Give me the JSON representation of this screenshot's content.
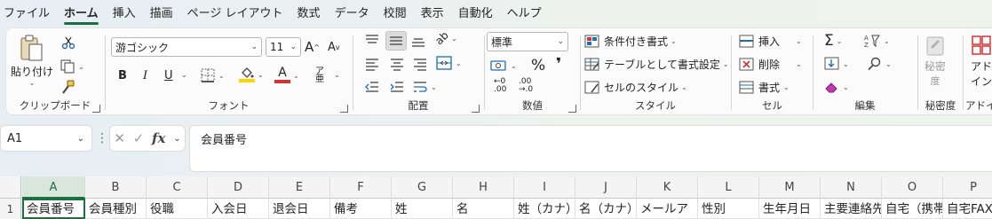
{
  "menu": [
    "ファイル",
    "ホーム",
    "挿入",
    "描画",
    "ページ レイアウト",
    "数式",
    "データ",
    "校閲",
    "表示",
    "自動化",
    "ヘルプ"
  ],
  "active_tab": "ホーム",
  "clipboard": {
    "paste_label": "貼り付け",
    "group_label": "クリップボード"
  },
  "font": {
    "font_name": "游ゴシック",
    "font_size": "11",
    "bold": "B",
    "italic": "I",
    "underline": "U",
    "group_label": "フォント",
    "underline_color": "#ffd400",
    "font_color": "#d13438"
  },
  "alignment": {
    "group_label": "配置"
  },
  "number": {
    "format": "標準",
    "percent": "%",
    "comma": "❜",
    "group_label": "数値"
  },
  "styles": {
    "conditional": "条件付き書式",
    "as_table": "テーブルとして書式設定",
    "cell_styles": "セルのスタイル",
    "group_label": "スタイル"
  },
  "cells": {
    "insert": "挿入",
    "delete": "削除",
    "format": "書式",
    "group_label": "セル"
  },
  "editing": {
    "group_label": "編集"
  },
  "sensitivity": {
    "label_line1": "秘密",
    "label_line2": "度",
    "group_label": "秘密度"
  },
  "addins": {
    "label_line1": "アド",
    "label_line2": "イン",
    "group_label": "アドイ"
  },
  "formula_bar": {
    "name_box": "A1",
    "formula": "会員番号"
  },
  "columns": [
    "A",
    "B",
    "C",
    "D",
    "E",
    "F",
    "G",
    "H",
    "I",
    "J",
    "K",
    "L",
    "M",
    "N",
    "O",
    "P"
  ],
  "row_number": "1",
  "row1": [
    "会員番号",
    "会員種別",
    "役職",
    "入会日",
    "退会日",
    "備考",
    "姓",
    "名",
    "姓（カナ）",
    "名（カナ）",
    "メールア",
    "性別",
    "生年月日",
    "主要連絡先",
    "自宅（携帯",
    "自宅FAX"
  ]
}
